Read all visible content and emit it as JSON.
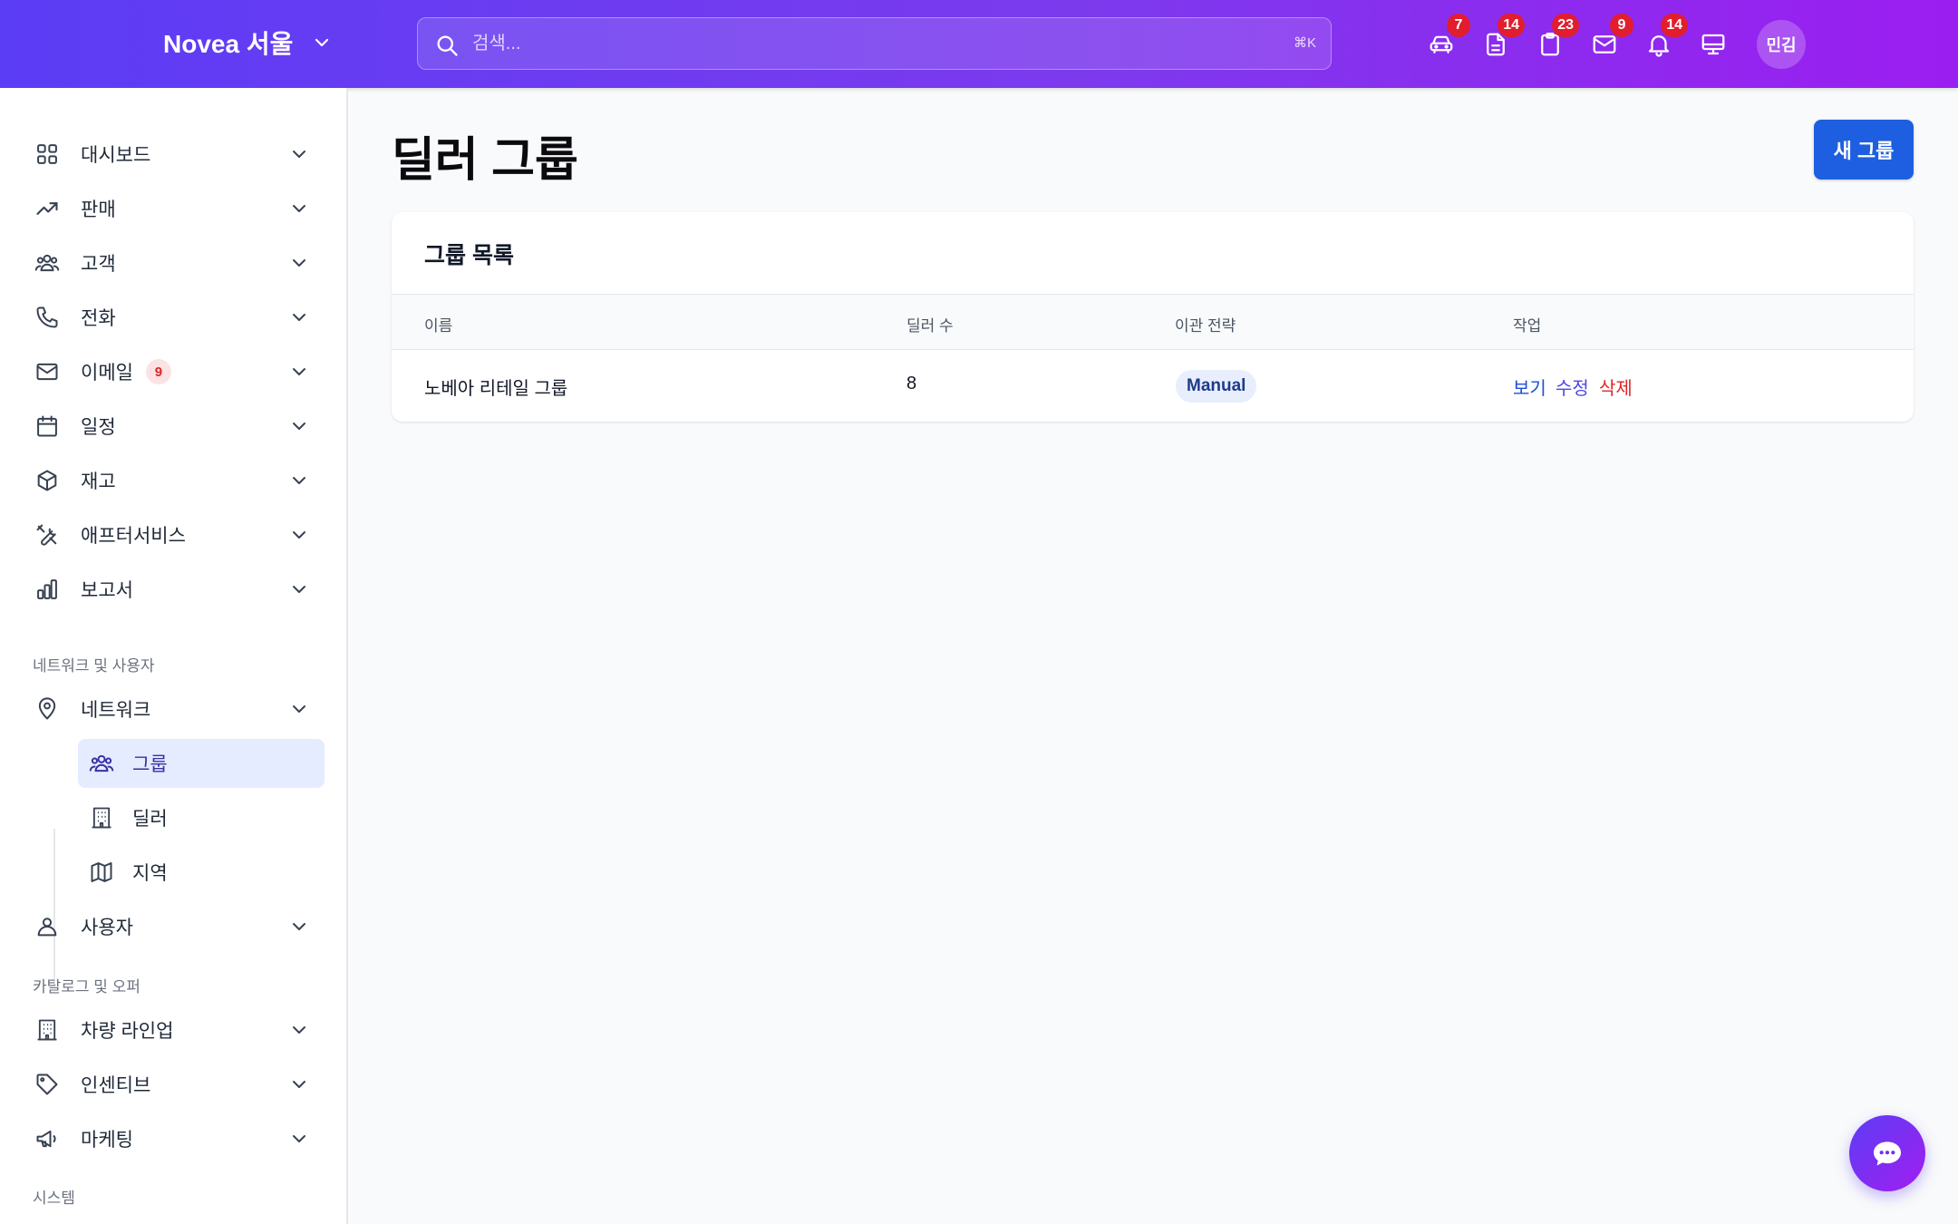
{
  "header": {
    "brand": "Novea 서울",
    "search_placeholder": "검색...",
    "search_shortcut": "⌘K",
    "icons": [
      {
        "name": "car-icon",
        "badge": "7"
      },
      {
        "name": "document-icon",
        "badge": "14"
      },
      {
        "name": "clipboard-icon",
        "badge": "23"
      },
      {
        "name": "mail-icon",
        "badge": "9"
      },
      {
        "name": "bell-icon",
        "badge": "14"
      },
      {
        "name": "monitor-icon",
        "badge": ""
      }
    ],
    "avatar": "민김"
  },
  "sidebar": {
    "items": [
      {
        "label": "대시보드",
        "icon": "dashboard-grid-icon"
      },
      {
        "label": "판매",
        "icon": "trending-up-icon"
      },
      {
        "label": "고객",
        "icon": "users-icon"
      },
      {
        "label": "전화",
        "icon": "phone-icon"
      },
      {
        "label": "이메일",
        "icon": "envelope-icon",
        "badge": "9"
      },
      {
        "label": "일정",
        "icon": "calendar-icon"
      },
      {
        "label": "재고",
        "icon": "box-icon"
      },
      {
        "label": "애프터서비스",
        "icon": "tools-icon"
      },
      {
        "label": "보고서",
        "icon": "bar-chart-icon"
      }
    ],
    "section_network": "네트워크 및 사용자",
    "network": {
      "label": "네트워크",
      "icon": "map-pin-icon"
    },
    "network_sub": [
      {
        "label": "그룹",
        "icon": "users-group-icon",
        "active": true
      },
      {
        "label": "딜러",
        "icon": "building-icon"
      },
      {
        "label": "지역",
        "icon": "map-icon"
      }
    ],
    "users": {
      "label": "사용자",
      "icon": "user-icon"
    },
    "section_catalog": "카탈로그 및 오퍼",
    "catalog": [
      {
        "label": "차량 라인업",
        "icon": "building-icon"
      },
      {
        "label": "인센티브",
        "icon": "tag-icon"
      },
      {
        "label": "마케팅",
        "icon": "megaphone-icon"
      }
    ],
    "section_system": "시스템"
  },
  "main": {
    "title": "딜러 그룹",
    "new_button": "새 그룹",
    "card_title": "그룹 목록",
    "columns": [
      "이름",
      "딜러 수",
      "이관 전략",
      "작업"
    ],
    "rows": [
      {
        "name": "노베아 리테일 그룹",
        "dealer_count": "8",
        "strategy": "Manual",
        "actions": {
          "view": "보기",
          "edit": "수정",
          "delete": "삭제"
        }
      }
    ]
  },
  "colors": {
    "header_gradient_start": "#5b3df5",
    "header_gradient_end": "#9b1ef0",
    "primary": "#1d5fe0",
    "badge": "#e11d2e",
    "delete": "#dc2626"
  }
}
